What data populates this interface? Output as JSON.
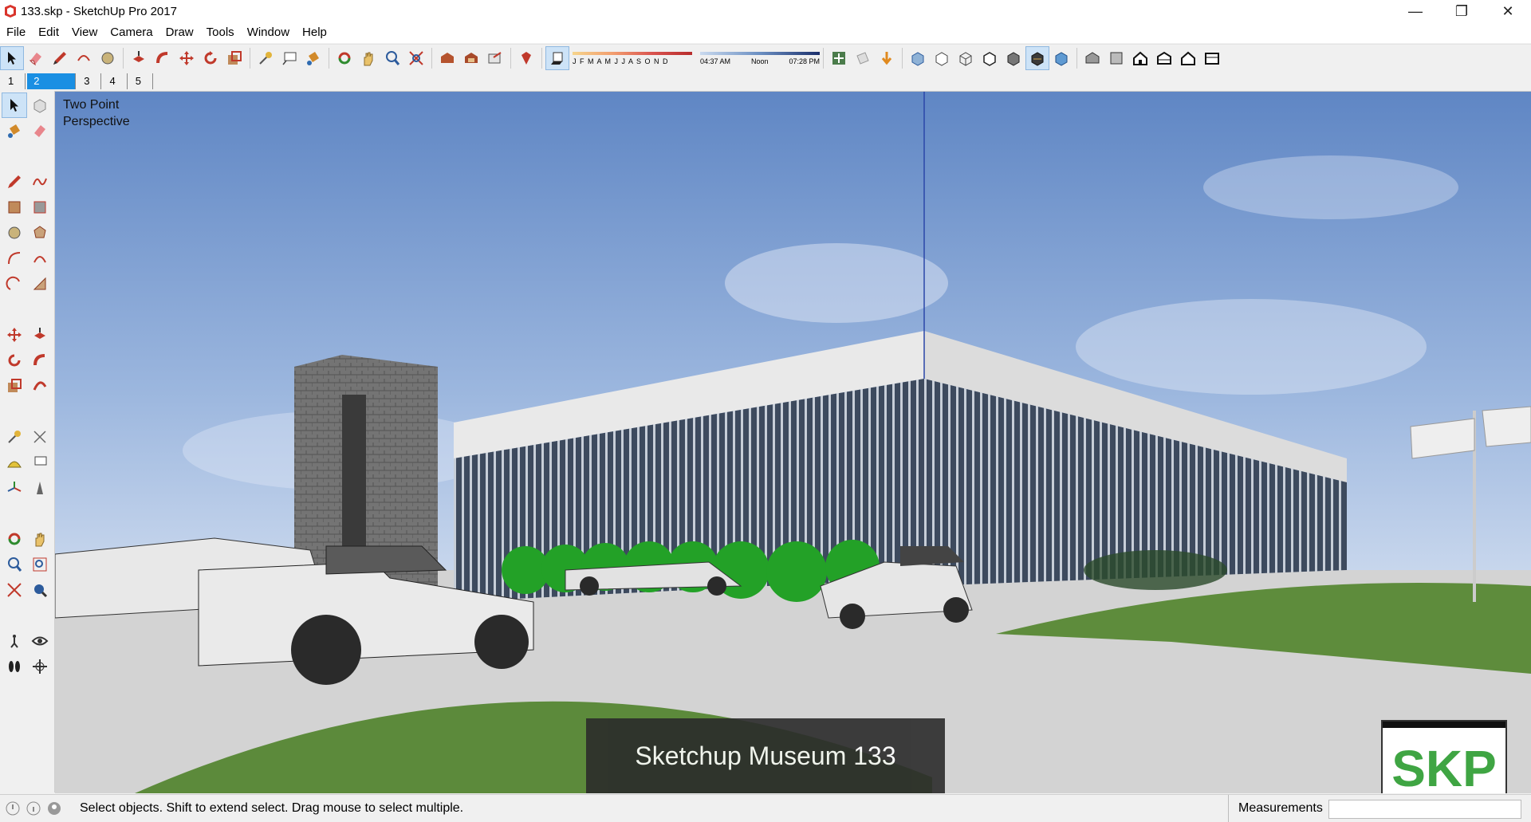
{
  "window": {
    "title": "133.skp - SketchUp Pro 2017",
    "minimize_glyph": "—",
    "restore_glyph": "❐",
    "close_glyph": "✕"
  },
  "menu": [
    "File",
    "Edit",
    "View",
    "Camera",
    "Draw",
    "Tools",
    "Window",
    "Help"
  ],
  "toolbar": {
    "icons": [
      "select-icon",
      "eraser-icon",
      "pencil-icon",
      "shape-icon",
      "circle-icon",
      "pushpull-icon",
      "followme-icon",
      "move-icon",
      "rotate-icon",
      "scale-icon",
      "tape-icon",
      "text-icon",
      "paint-icon",
      "orbit-icon",
      "pan-icon",
      "zoom-icon",
      "zoom-extents-icon",
      "warehouse-icon",
      "extension-icon",
      "layout-icon",
      "ruby-icon"
    ],
    "shadows": {
      "months": "J F M A M J J A S O N D",
      "time_start": "04:37 AM",
      "time_mid": "Noon",
      "time_end": "07:28 PM"
    }
  },
  "scenes": [
    "1",
    "2",
    "3",
    "4",
    "5"
  ],
  "active_scene": "2",
  "viewport": {
    "label_line1": "Two Point",
    "label_line2": "Perspective",
    "caption": "Sketchup Museum 133",
    "badge": "SKP"
  },
  "status": {
    "message": "Select objects. Shift to extend select. Drag mouse to select multiple.",
    "measurements_label": "Measurements",
    "measurements_value": ""
  },
  "colors": {
    "sky_top": "#6b8fc9",
    "sky_bottom": "#c9daf0",
    "lawn": "#5c8a3b",
    "pavement": "#d6d6d6",
    "tree": "#27a12c",
    "skp_green": "#3fa543"
  }
}
